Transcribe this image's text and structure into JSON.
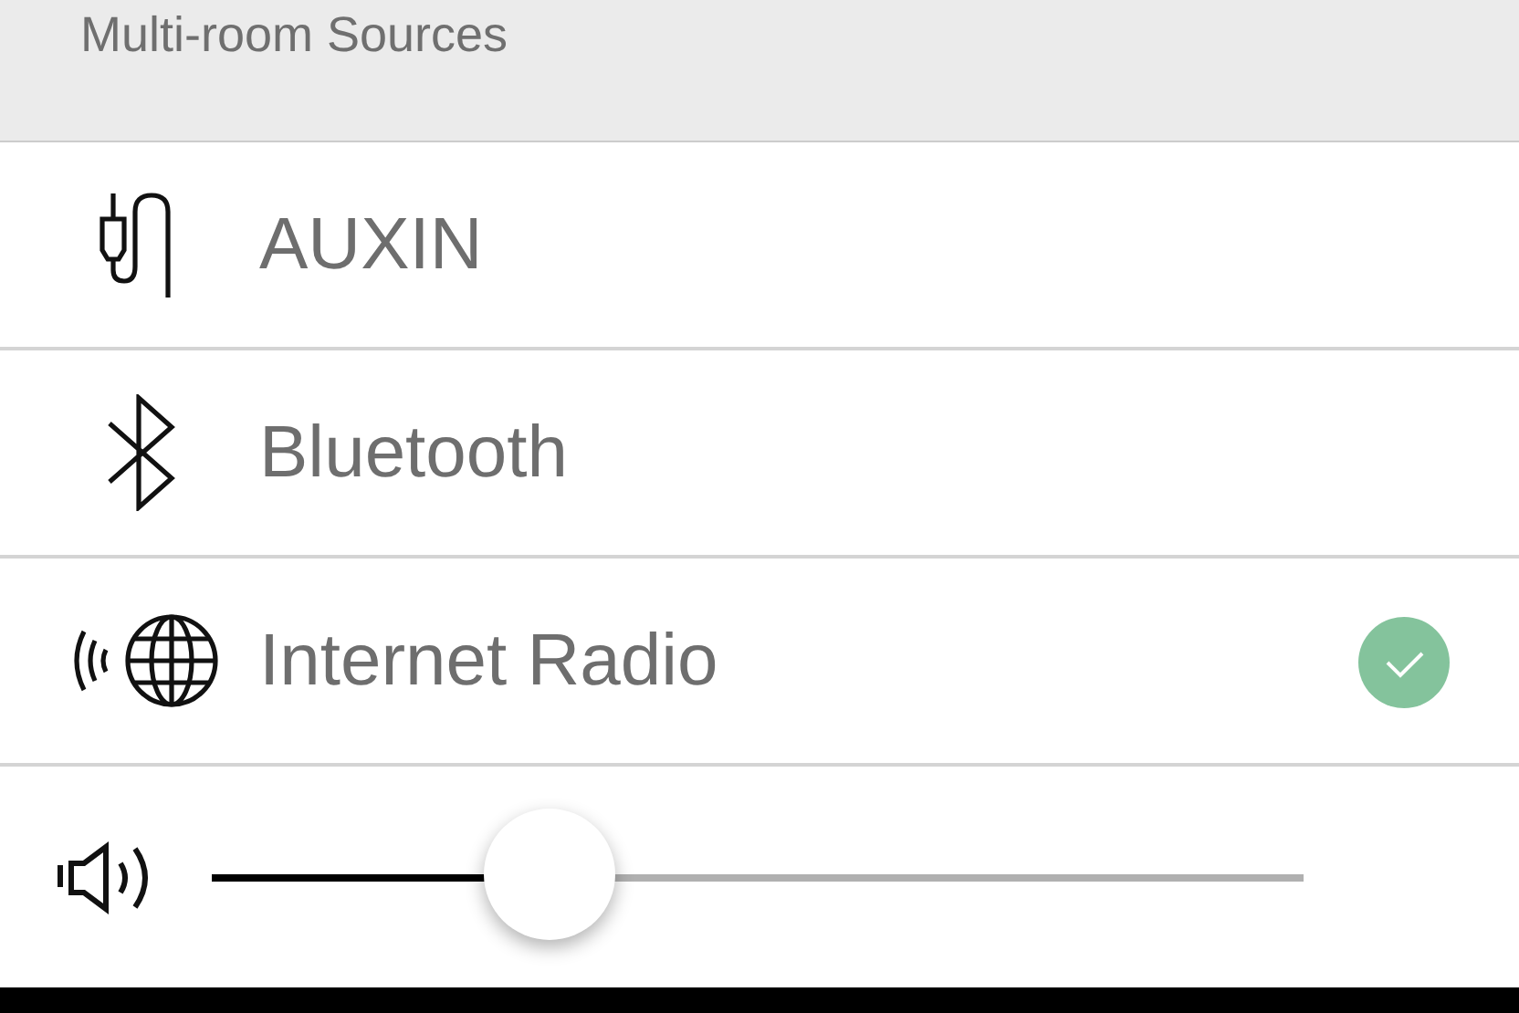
{
  "header": {
    "title": "Multi-room Sources"
  },
  "sources": [
    {
      "kind": "aux",
      "label": "AUXIN",
      "selected": false
    },
    {
      "kind": "bluetooth",
      "label": "Bluetooth",
      "selected": false
    },
    {
      "kind": "internet",
      "label": "Internet Radio",
      "selected": true
    }
  ],
  "volume": {
    "level": 0.31
  }
}
